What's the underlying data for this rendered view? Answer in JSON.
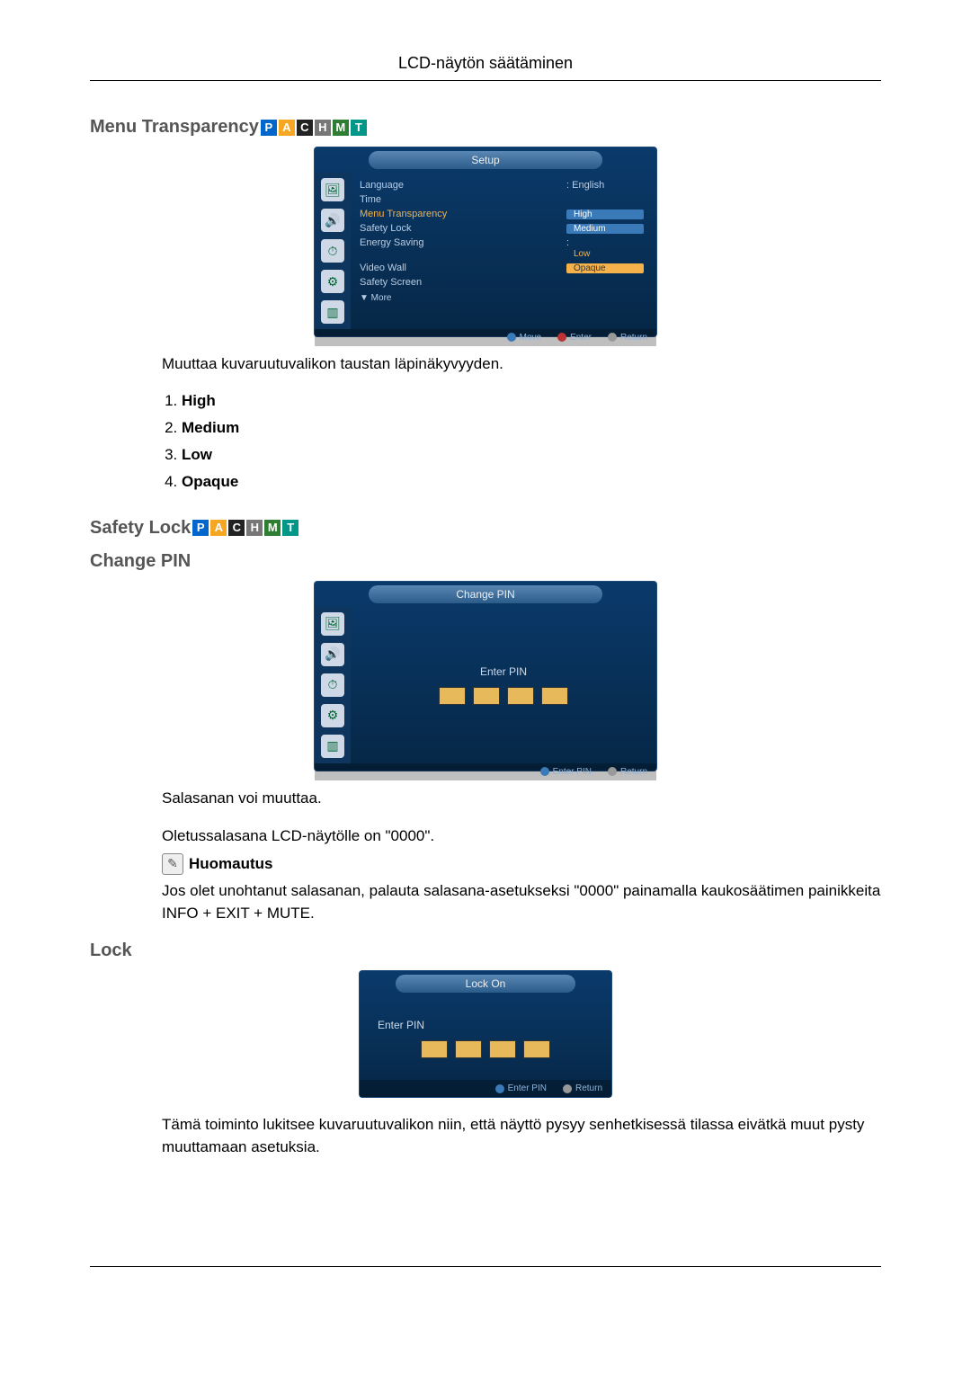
{
  "page_header": "LCD-näytön säätäminen",
  "sections": {
    "menu_transparency": {
      "title": "Menu Transparency",
      "badges": [
        "P",
        "A",
        "C",
        "H",
        "M",
        "T"
      ],
      "osd": {
        "title": "Setup",
        "side_icons": [
          "pic",
          "sound",
          "timer",
          "setup",
          "multi"
        ],
        "rows": {
          "language_label": "Language",
          "language_value": ": English",
          "time_label": "Time",
          "mt_label": "Menu Transparency",
          "opts": {
            "high": "High",
            "medium": "Medium",
            "low": "Low",
            "opaque": "Opaque"
          },
          "safety_lock_label": "Safety Lock",
          "energy_saving_label": "Energy Saving",
          "energy_saving_colon": ":",
          "video_wall_label": "Video Wall",
          "safety_screen_label": "Safety Screen",
          "more_label": "▼ More"
        },
        "footer": {
          "move": "Move",
          "enter": "Enter",
          "return": "Return"
        }
      },
      "desc": "Muuttaa kuvaruutuvalikon taustan läpinäkyvyyden.",
      "list": [
        "High",
        "Medium",
        "Low",
        "Opaque"
      ]
    },
    "safety_lock": {
      "title": "Safety Lock",
      "badges": [
        "P",
        "A",
        "C",
        "H",
        "M",
        "T"
      ]
    },
    "change_pin": {
      "title": "Change PIN",
      "osd": {
        "title": "Change PIN",
        "enter_pin": "Enter PIN",
        "footer": {
          "enter_pin": "Enter PIN",
          "return": "Return"
        }
      },
      "p1": "Salasanan voi muuttaa.",
      "p2": "Oletussalasana LCD-näytölle on \"0000\".",
      "note_label": "Huomautus",
      "note_body": "Jos olet unohtanut salasanan, palauta salasana-asetukseksi \"0000\" painamalla kaukosäätimen painikkeita INFO + EXIT + MUTE."
    },
    "lock": {
      "title": "Lock",
      "osd": {
        "title": "Lock On",
        "enter_pin": "Enter PIN",
        "footer": {
          "enter_pin": "Enter PIN",
          "return": "Return"
        }
      },
      "desc": "Tämä toiminto lukitsee kuvaruutuvalikon niin, että näyttö pysyy senhetkisessä tilassa eivätkä muut pysty muuttamaan asetuksia."
    }
  }
}
